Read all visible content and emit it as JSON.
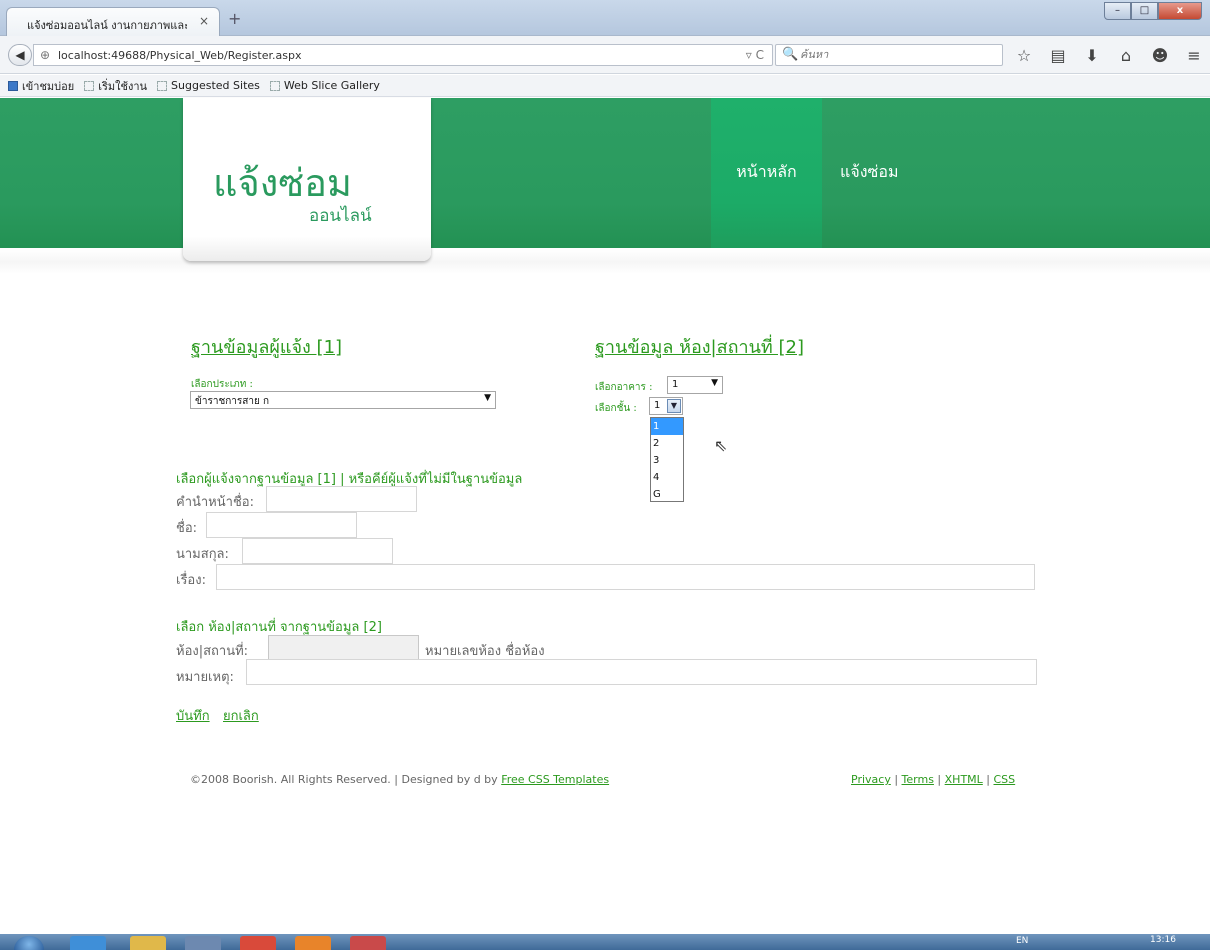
{
  "browser": {
    "tab_title": "แจ้งซ่อมออนไลน์ งานกายภาพและ...",
    "tab_close": "×",
    "new_tab": "+",
    "url": "localhost:49688/Physical_Web/Register.aspx",
    "search_placeholder": "ค้นหา",
    "bookmarks": [
      "เข้าชมบ่อย",
      "เริ่มใช้งาน",
      "Suggested Sites",
      "Web Slice Gallery"
    ]
  },
  "header": {
    "logo_main": "แจ้งซ่อม",
    "logo_sub": "ออนไลน์",
    "menu": [
      "หน้าหลัก",
      "แจ้งซ่อม"
    ]
  },
  "section1": {
    "title": "ฐานข้อมูลผู้แจ้ง [1]",
    "type_label": "เลือกประเภท :",
    "type_value": "ข้าราชการสาย ก"
  },
  "section2": {
    "title": "ฐานข้อมูล ห้อง|สถานที่ [2]",
    "building_label": "เลือกอาคาร :",
    "building_value": "1",
    "floor_label": "เลือกชั้น :",
    "floor_value": "1",
    "floor_options": [
      "1",
      "2",
      "3",
      "4",
      "G"
    ]
  },
  "reporter": {
    "heading": "เลือกผู้แจ้งจากฐานข้อมูล [1] | หรือคีย์ผู้แจ้งที่ไม่มีในฐานข้อมูล",
    "prefix_label": "คำนำหน้าชื่อ:",
    "firstname_label": "ชื่อ:",
    "lastname_label": "นามสกุล:",
    "subject_label": "เรื่อง:"
  },
  "location": {
    "heading": "เลือก ห้อง|สถานที่ จากฐานข้อมูล [2]",
    "room_label": "ห้อง|สถานที่:",
    "room_hint": "หมายเลขห้อง ชื่อห้อง",
    "note_label": "หมายเหตุ:"
  },
  "actions": {
    "save": "บันทึก",
    "cancel": "ยกเลิก"
  },
  "footer": {
    "copyright": "©2008 Boorish. All Rights Reserved. | Designed by d by ",
    "templates_link": "Free CSS Templates",
    "links": [
      "Privacy",
      "Terms",
      "XHTML",
      "CSS"
    ],
    "separator": " | "
  },
  "taskbar": {
    "lang": "EN",
    "time": "13:16"
  }
}
